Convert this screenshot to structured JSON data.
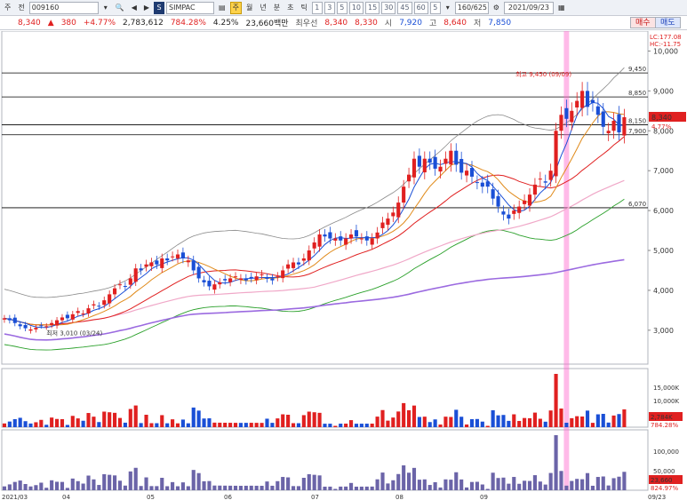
{
  "toolbar": {
    "items": [
      "주",
      "전",
      "009160",
      "▾",
      "🔍",
      "◀",
      "▶",
      "S",
      "SIMPAC",
      "▤",
      "주",
      "월",
      "년",
      "분",
      "초",
      "틱",
      "1",
      "3",
      "5",
      "10",
      "15",
      "30",
      "45",
      "60",
      "5",
      "▾",
      "160/625",
      "⚙",
      "2021/09/23",
      "▦"
    ]
  },
  "quote": {
    "price": "8,340",
    "change": "380",
    "change_pct": "+4.77%",
    "volume": "2,783,612",
    "volume_ratio": "784.28%",
    "turnover": "4.25%",
    "amount": "23,660백만",
    "best_bid_label": "최우선",
    "best_bid": "8,340",
    "best_ask": "8,330",
    "open_label": "시",
    "open": "7,920",
    "high_label": "고",
    "high": "8,640",
    "low_label": "저",
    "low": "7,850",
    "buy_label": "매수",
    "sell_label": "매도"
  },
  "colors": {
    "up": "#e02020",
    "down": "#1a4fd6",
    "ma5": "#1a4fd6",
    "ma10": "#e08a1a",
    "ma20": "#e02020",
    "ma60": "#f0a8c8",
    "ma120": "#9b6ae0",
    "bollinger": "#8a8a8a",
    "envelope": "#2aa02a",
    "selected_day": "#ff66cc"
  },
  "chart_data": [
    {
      "type": "candlestick",
      "title": "SIMPAC (009160) daily",
      "x_labels": [
        "2021/03",
        "04",
        "05",
        "06",
        "07",
        "08",
        "09",
        "09/23"
      ],
      "y_ticks": [
        3000,
        4000,
        5000,
        6000,
        7000,
        8000,
        9000,
        10000
      ],
      "ylim": [
        2150,
        10500
      ],
      "scale_info": [
        "LC:177.08",
        "HC:-11.75"
      ],
      "levels": [
        {
          "value": 9450,
          "label": "9,450"
        },
        {
          "value": 8850,
          "label": "8,850"
        },
        {
          "value": 8150,
          "label": "8,150"
        },
        {
          "value": 7900,
          "label": "7,900"
        },
        {
          "value": 6070,
          "label": "6,070"
        }
      ],
      "annotations": {
        "high": "최고 9,450 (09/09)",
        "low": "최저 3,010 (03/24)"
      },
      "current_price": "8,340",
      "current_change": "4.77%",
      "closes": [
        3300,
        3250,
        3180,
        3100,
        3050,
        3020,
        3060,
        3120,
        3100,
        3180,
        3250,
        3320,
        3300,
        3400,
        3480,
        3420,
        3550,
        3650,
        3600,
        3750,
        3900,
        4050,
        4150,
        4100,
        4300,
        4550,
        4500,
        4650,
        4700,
        4650,
        4800,
        4750,
        4850,
        4900,
        4800,
        4750,
        4500,
        4300,
        4200,
        4100,
        4150,
        4200,
        4250,
        4300,
        4350,
        4300,
        4250,
        4300,
        4350,
        4400,
        4300,
        4250,
        4350,
        4500,
        4650,
        4700,
        4650,
        4800,
        5000,
        5200,
        5400,
        5350,
        5300,
        5300,
        5250,
        5300,
        5400,
        5350,
        5300,
        5250,
        5300,
        5450,
        5700,
        5800,
        5950,
        6200,
        6600,
        6900,
        7300,
        7100,
        7300,
        7200,
        7050,
        7100,
        7300,
        7500,
        7150,
        6950,
        7000,
        6850,
        6700,
        6600,
        6600,
        6300,
        6100,
        5900,
        5800,
        6000,
        6100,
        6250,
        6400,
        6650,
        6800,
        6700,
        7000,
        8000,
        8400,
        8300,
        8500,
        8750,
        9000,
        8600,
        8700,
        8400,
        8100,
        8000,
        8250,
        7960,
        8340
      ],
      "volume": {
        "y_ticks": [
          "5,000K",
          "10,000K",
          "15,000K"
        ],
        "current": "2,784K",
        "ratio": "784.28%"
      },
      "amount": {
        "y_ticks": [
          "50,000",
          "100,000"
        ],
        "current": "23,660",
        "ratio": "824.97%"
      }
    }
  ]
}
